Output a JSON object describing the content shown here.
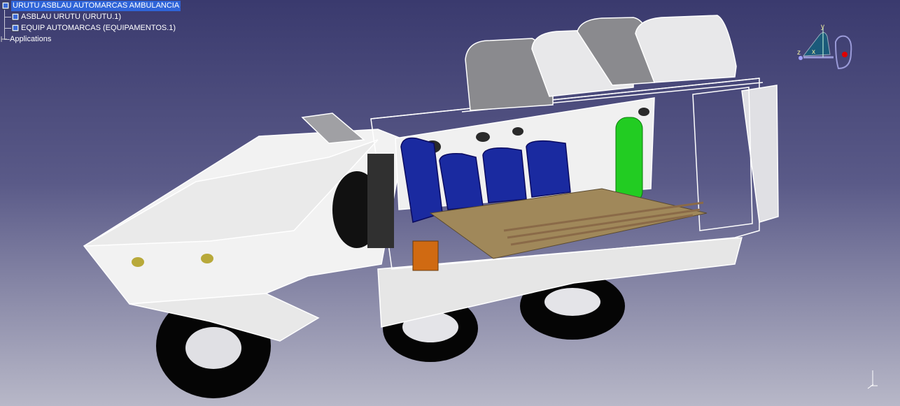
{
  "spec_tree": {
    "root_label": "URUTU ASBLAU AUTOMARCAS AMBULANCIA",
    "children": [
      {
        "label": "ASBLAU URUTU (URUTU.1)"
      },
      {
        "label": "EQUIP AUTOMARCAS (EQUIPAMENTOS.1)"
      }
    ],
    "applications_label": "Applications"
  },
  "compass": {
    "axis_y": "y",
    "axis_x": "x",
    "axis_z": "z"
  },
  "colors": {
    "background_top": "#3a3a6e",
    "background_bottom": "#b8b8c8",
    "selection": "#2f64d8",
    "seats": "#1a2aa0",
    "oxygen_tank": "#22cc22",
    "stretcher": "#8a6a48"
  },
  "icons": {
    "product_node": "product-node-icon",
    "applications": "applications-icon",
    "compass": "compass-icon"
  }
}
